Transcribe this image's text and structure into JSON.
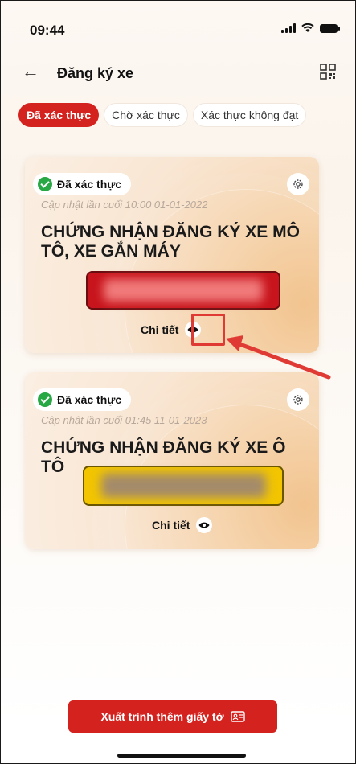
{
  "status_bar": {
    "time": "09:44"
  },
  "header": {
    "title": "Đăng ký xe",
    "back_icon": "arrow-left-icon",
    "qr_icon": "qr-scan-icon"
  },
  "tabs": [
    {
      "label": "Đã xác thực",
      "active": true
    },
    {
      "label": "Chờ xác thực",
      "active": false
    },
    {
      "label": "Xác thực không đạt",
      "active": false
    }
  ],
  "cards": [
    {
      "status": "Đã xác thực",
      "updated": "Cập nhật lần cuối 10:00 01-01-2022",
      "name": "CHỨNG NHẬN ĐĂNG KÝ XE MÔ TÔ, XE GẮN MÁY",
      "plate_color": "#c8141c",
      "detail_label": "Chi tiết"
    },
    {
      "status": "Đã xác thực",
      "updated": "Cập nhật lần cuối 01:45 11-01-2023",
      "name": "CHỨNG NHẬN ĐĂNG KÝ XE Ô TÔ",
      "plate_color": "#f2c500",
      "detail_label": "Chi tiết"
    }
  ],
  "footer": {
    "button_label": "Xuất trình thêm giấy tờ"
  },
  "colors": {
    "accent": "#d4231f",
    "verified": "#28a745",
    "annotation": "#e03a35"
  }
}
